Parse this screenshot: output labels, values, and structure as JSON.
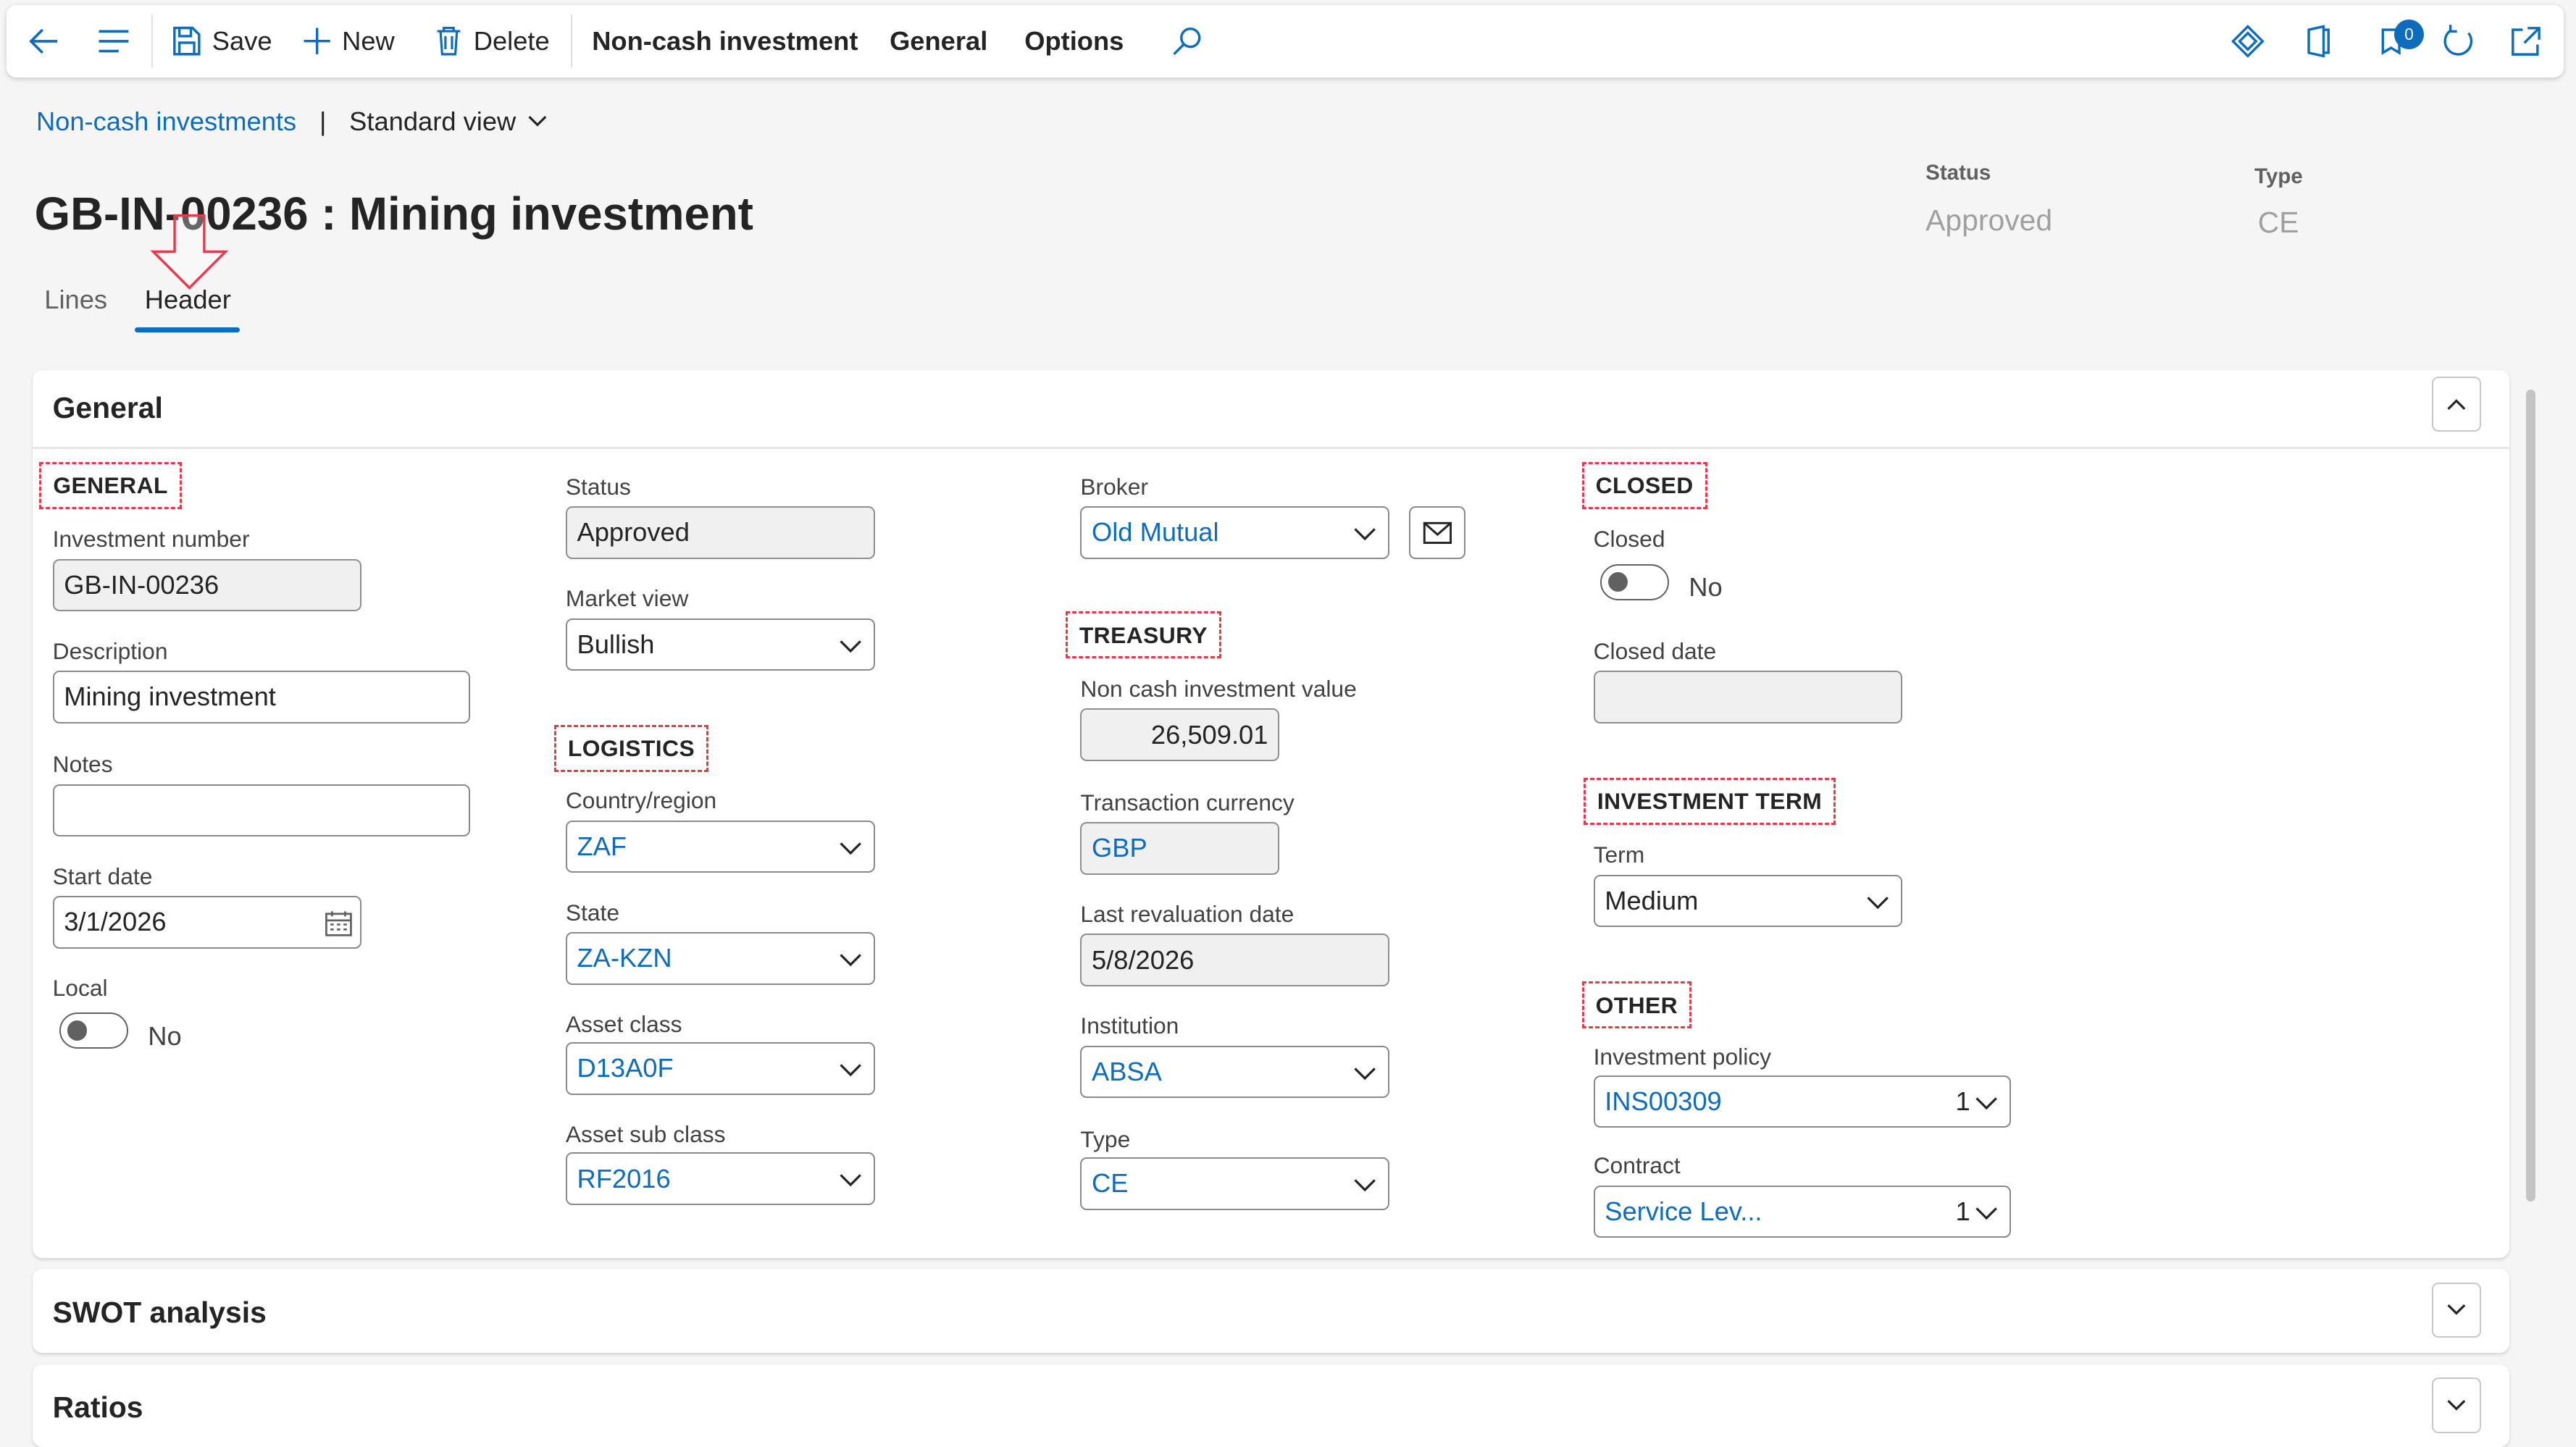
{
  "toolbar": {
    "save_label": "Save",
    "new_label": "New",
    "delete_label": "Delete",
    "menu_noncash": "Non-cash investment",
    "menu_general": "General",
    "menu_options": "Options",
    "notification_count": "0"
  },
  "breadcrumb": {
    "link": "Non-cash investments",
    "separator": "|",
    "view": "Standard view"
  },
  "page": {
    "title": "GB-IN-00236 : Mining investment"
  },
  "header_fields": {
    "status_label": "Status",
    "status_value": "Approved",
    "type_label": "Type",
    "type_value": "CE"
  },
  "tabs": {
    "lines": "Lines",
    "header": "Header"
  },
  "general_card": {
    "title": "General",
    "groups": {
      "general": "GENERAL",
      "logistics": "LOGISTICS",
      "treasury": "TREASURY",
      "closed": "CLOSED",
      "investment_term": "INVESTMENT TERM",
      "other": "OTHER"
    },
    "fields": {
      "investment_number_label": "Investment number",
      "investment_number": "GB-IN-00236",
      "description_label": "Description",
      "description": "Mining investment",
      "notes_label": "Notes",
      "notes": "",
      "start_date_label": "Start date",
      "start_date": "3/1/2026",
      "local_label": "Local",
      "local_value": "No",
      "status_label": "Status",
      "status": "Approved",
      "market_view_label": "Market view",
      "market_view": "Bullish",
      "country_label": "Country/region",
      "country": "ZAF",
      "state_label": "State",
      "state": "ZA-KZN",
      "asset_class_label": "Asset class",
      "asset_class": "D13A0F",
      "asset_sub_class_label": "Asset sub class",
      "asset_sub_class": "RF2016",
      "broker_label": "Broker",
      "broker": "Old Mutual",
      "noncash_value_label": "Non cash investment value",
      "noncash_value": "26,509.01",
      "currency_label": "Transaction currency",
      "currency": "GBP",
      "last_reval_label": "Last revaluation date",
      "last_reval": "5/8/2026",
      "institution_label": "Institution",
      "institution": "ABSA",
      "type_label": "Type",
      "type": "CE",
      "closed_label": "Closed",
      "closed_value": "No",
      "closed_date_label": "Closed date",
      "closed_date": "",
      "term_label": "Term",
      "term": "Medium",
      "policy_label": "Investment policy",
      "policy": "INS00309",
      "policy_count": "1",
      "contract_label": "Contract",
      "contract": "Service Lev...",
      "contract_count": "1"
    }
  },
  "swot_card": {
    "title": "SWOT analysis"
  },
  "ratios_card": {
    "title": "Ratios"
  },
  "colors": {
    "accent": "#0f6cbd",
    "annotation": "#e23b4a"
  }
}
